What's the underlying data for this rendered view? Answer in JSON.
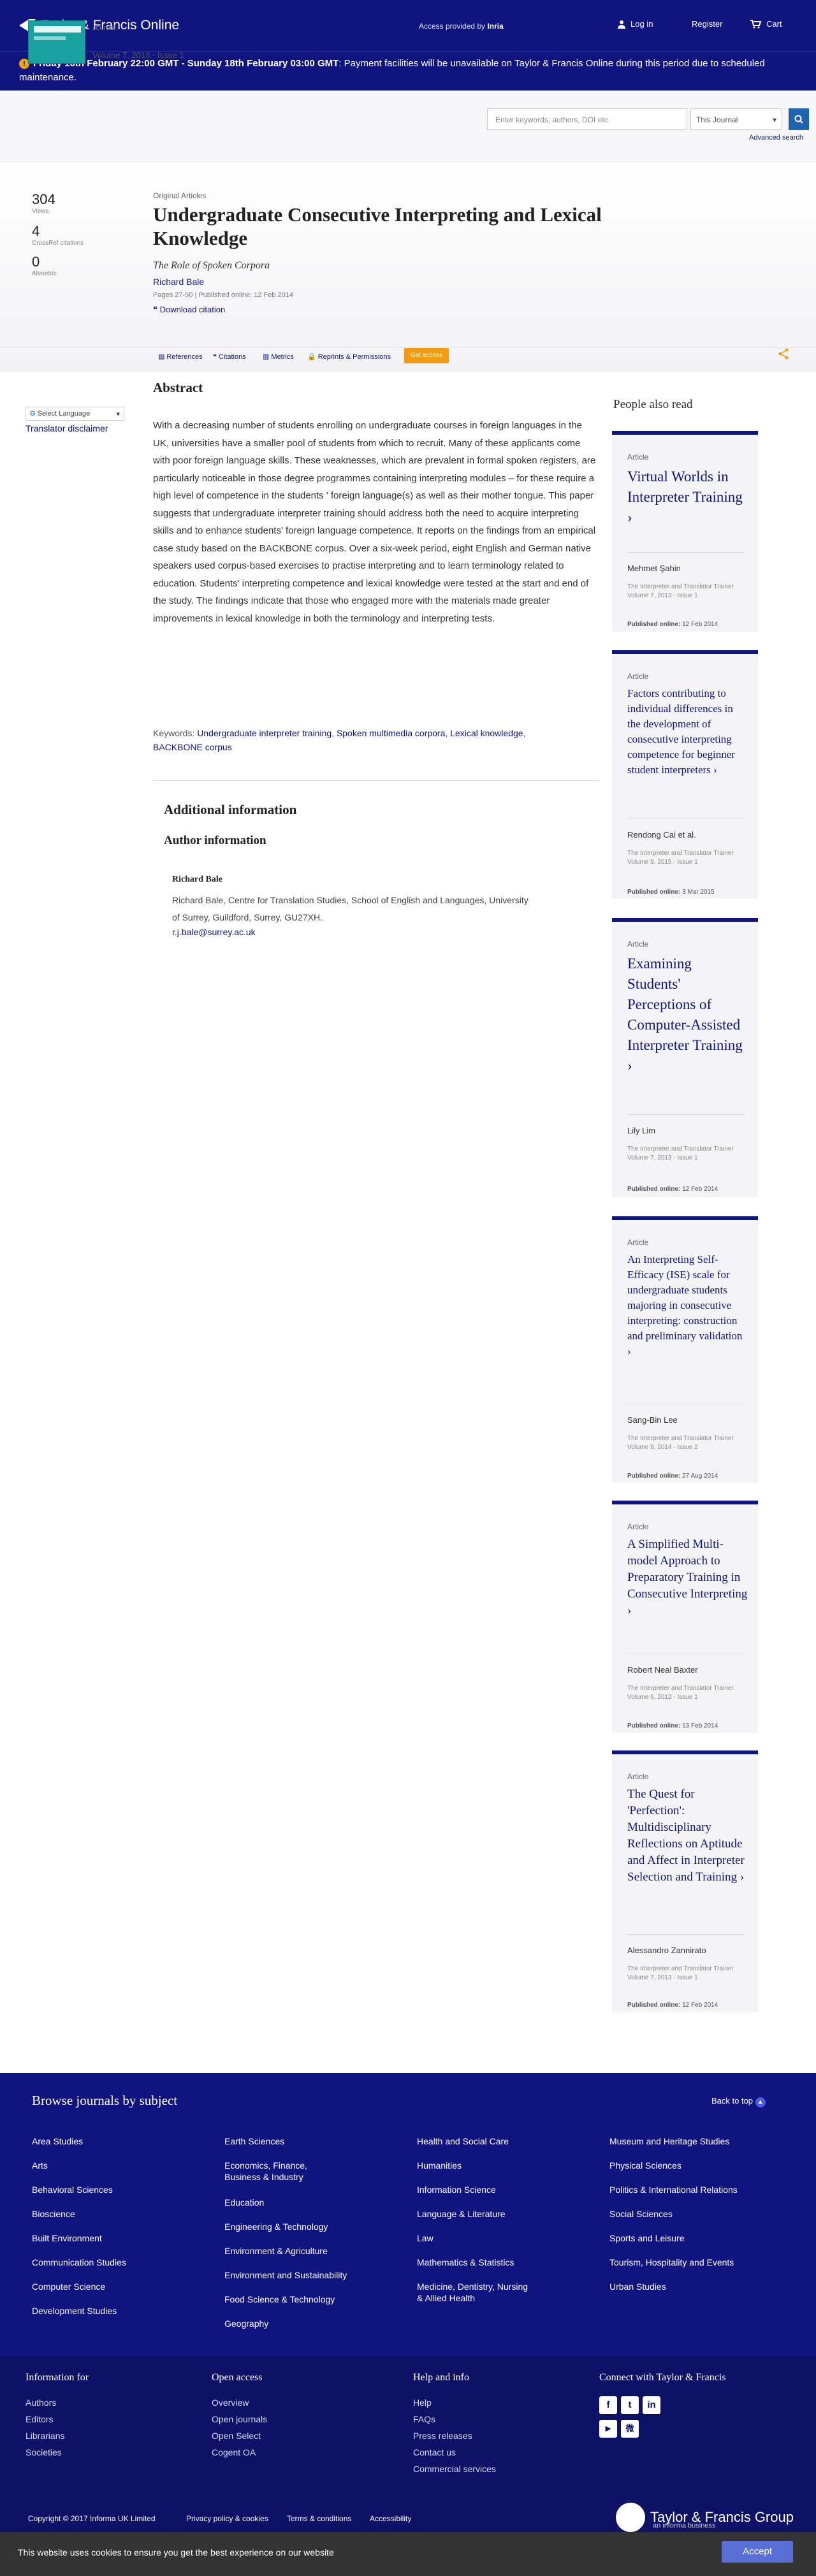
{
  "header": {
    "brand": "Taylor & Francis Online",
    "access_prefix": "Access provided by",
    "access_org": "Inria",
    "login": "Log in",
    "register": "Register",
    "cart": "Cart"
  },
  "alert": {
    "bold": "Friday 16th February 22:00 GMT - Sunday 18th February 03:00 GMT",
    "text": ": Payment facilities will be unavailable on Taylor & Francis Online during this period due to scheduled maintenance."
  },
  "journal": {
    "label": "Journal",
    "title": "The Interpreter and Translator Trainer",
    "volume": "Volume 7, 2013 - Issue 1"
  },
  "search": {
    "placeholder": "Enter keywords, authors, DOI etc.",
    "scope": "This Journal",
    "advanced": "Advanced search"
  },
  "metrics": [
    {
      "value": "304",
      "label": "Views"
    },
    {
      "value": "4",
      "label": "CrossRef citations"
    },
    {
      "value": "0",
      "label": "Altmetric"
    }
  ],
  "article": {
    "type": "Original Articles",
    "title": "Undergraduate Consecutive Interpreting and Lexical Knowledge",
    "subtitle": "The Role of Spoken Corpora",
    "author": "Richard Bale",
    "pages": "Pages 27-50",
    "published": "Published online: 12 Feb 2014",
    "download": "Download citation"
  },
  "tabs": {
    "references": "References",
    "citations": "Citations",
    "metrics": "Metrics",
    "reprints": "Reprints & Permissions",
    "get_access": "Get access"
  },
  "translate": {
    "select": "Select Language",
    "disclaimer": "Translator disclaimer"
  },
  "abstract": {
    "heading": "Abstract",
    "text": "With a decreasing number of students enrolling on undergraduate courses in foreign languages in the UK, universities have a smaller pool of students from which to recruit. Many of these applicants come with poor foreign language skills. These weaknesses, which are prevalent in formal spoken registers, are particularly noticeable in those degree programmes containing interpreting modules – for these require a high level of competence in the students ' foreign language(s) as well as their mother tongue. This paper suggests that undergraduate interpreter training should address both the need to acquire interpreting skills and to enhance students' foreign language competence. It reports on the findings from an empirical case study based on the BACKBONE corpus. Over a six-week period, eight English and German native speakers used corpus-based exercises to practise interpreting and to learn terminology related to education. Students' interpreting competence and lexical knowledge were tested at the start and end of the study. The findings indicate that those who engaged more with the materials made greater improvements in lexical knowledge in both the terminology and interpreting tests."
  },
  "keywords": {
    "label": "Keywords:",
    "items": [
      "Undergraduate interpreter training",
      "Spoken multimedia corpora",
      "Lexical knowledge",
      "BACKBONE corpus"
    ]
  },
  "additional": {
    "heading": "Additional information",
    "author_heading": "Author information",
    "author_name": "Richard Bale",
    "affiliation": "Richard Bale, Centre for Translation Studies, School of English and Languages, University of Surrey, Guildford, Surrey, GU27XH.",
    "email": "r.j.bale@surrey.ac.uk"
  },
  "people_also_read": {
    "heading": "People also read",
    "cards": [
      {
        "label": "Article",
        "title": "Virtual Worlds in Interpreter Training",
        "author": "Mehmet Şahin",
        "journal": "The Interpreter and Translator Trainer",
        "volume": "Volume 7, 2013 - Issue 1",
        "published_label": "Published online:",
        "published": "12 Feb 2014"
      },
      {
        "label": "Article",
        "title": "Factors contributing to individual differences in the development of consecutive interpreting competence for beginner student interpreters",
        "author": "Rendong Cai et al.",
        "journal": "The Interpreter and Translator Trainer",
        "volume": "Volume 9, 2015 - Issue 1",
        "published_label": "Published online:",
        "published": "3 Mar 2015"
      },
      {
        "label": "Article",
        "title": "Examining Students' Perceptions of Computer-Assisted Interpreter Training",
        "author": "Lily Lim",
        "journal": "The Interpreter and Translator Trainer",
        "volume": "Volume 7, 2013 - Issue 1",
        "published_label": "Published online:",
        "published": "12 Feb 2014"
      },
      {
        "label": "Article",
        "title": "An Interpreting Self-Efficacy (ISE) scale for undergraduate students majoring in consecutive interpreting: construction and preliminary validation",
        "author": "Sang-Bin Lee",
        "journal": "The Interpreter and Translator Trainer",
        "volume": "Volume 8, 2014 - Issue 2",
        "published_label": "Published online:",
        "published": "27 Aug 2014"
      },
      {
        "label": "Article",
        "title": "A Simplified Multi-model Approach to Preparatory Training in Consecutive Interpreting",
        "author": "Robert Neal Baxter",
        "journal": "The Interpreter and Translator Trainer",
        "volume": "Volume 6, 2012 - Issue 1",
        "published_label": "Published online:",
        "published": "13 Feb 2014"
      },
      {
        "label": "Article",
        "title": "The Quest for 'Perfection': Multidisciplinary Reflections on Aptitude and Affect in Interpreter Selection and Training",
        "author": "Alessandro Zannirato",
        "journal": "The Interpreter and Translator Trainer",
        "volume": "Volume 7, 2013 - Issue 1",
        "published_label": "Published online:",
        "published": "12 Feb 2014"
      }
    ]
  },
  "browse": {
    "heading": "Browse journals by subject",
    "back_to_top": "Back to top",
    "columns": [
      [
        "Area Studies",
        "Arts",
        "Behavioral Sciences",
        "Bioscience",
        "Built Environment",
        "Communication Studies",
        "Computer Science",
        "Development Studies"
      ],
      [
        "Earth Sciences",
        "Economics, Finance, Business & Industry",
        "Education",
        "Engineering & Technology",
        "Environment & Agriculture",
        "Environment and Sustainability",
        "Food Science & Technology",
        "Geography"
      ],
      [
        "Health and Social Care",
        "Humanities",
        "Information Science",
        "Language & Literature",
        "Law",
        "Mathematics & Statistics",
        "Medicine, Dentistry, Nursing & Allied Health"
      ],
      [
        "Museum and Heritage Studies",
        "Physical Sciences",
        "Politics & International Relations",
        "Social Sciences",
        "Sports and Leisure",
        "Tourism, Hospitality and Events",
        "Urban Studies"
      ]
    ]
  },
  "footer": {
    "info_heading": "Information for",
    "info": [
      "Authors",
      "Editors",
      "Librarians",
      "Societies"
    ],
    "open_heading": "Open access",
    "open": [
      "Overview",
      "Open journals",
      "Open Select",
      "Cogent OA"
    ],
    "help_heading": "Help and info",
    "help": [
      "Help",
      "FAQs",
      "Press releases",
      "Contact us",
      "Commercial services"
    ],
    "connect_heading": "Connect with Taylor & Francis",
    "copyright": "Copyright © 2017 Informa UK Limited",
    "legal": [
      "Privacy policy & cookies",
      "Terms & conditions",
      "Accessibility"
    ],
    "group": "Taylor & Francis Group",
    "group_sub": "an informa business"
  },
  "cookie": {
    "text": "This website uses cookies to ensure you get the best experience on our website",
    "accept": "Accept"
  },
  "colors": {
    "brand": "#10147e",
    "accent": "#f29c11",
    "cookie_bar": "#333333"
  }
}
